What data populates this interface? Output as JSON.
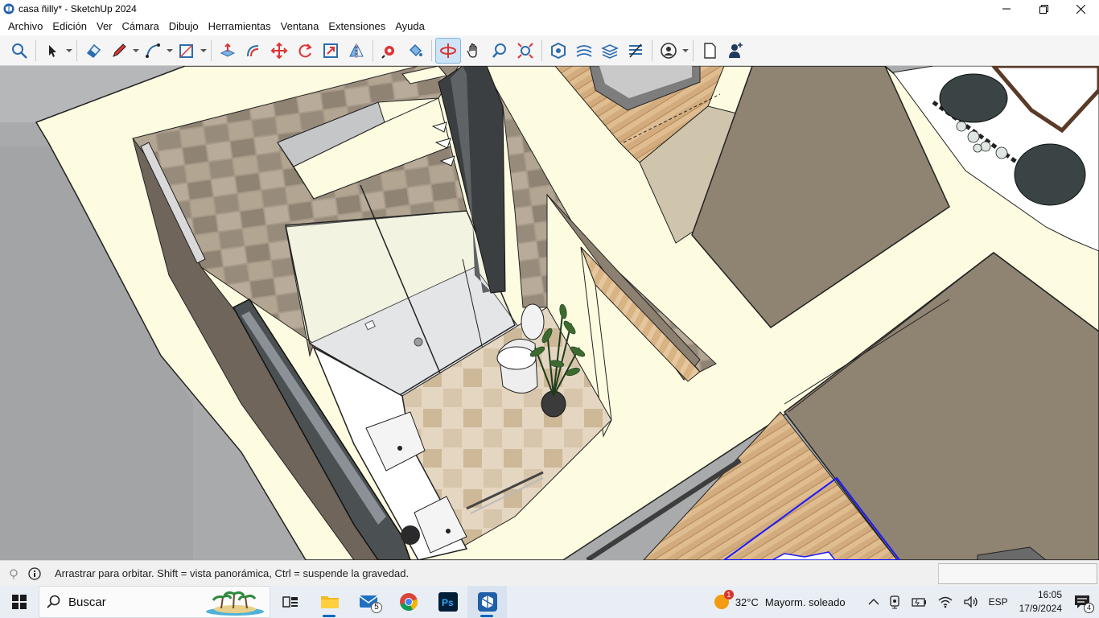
{
  "window": {
    "title": "casa ñilly* - SketchUp 2024",
    "app_icon": "sketchup-icon",
    "controls": [
      "minimize-icon",
      "restore-icon",
      "close-icon"
    ]
  },
  "menubar": {
    "items": [
      {
        "label": "Archivo"
      },
      {
        "label": "Edición"
      },
      {
        "label": "Ver"
      },
      {
        "label": "Cámara"
      },
      {
        "label": "Dibujo"
      },
      {
        "label": "Herramientas"
      },
      {
        "label": "Ventana"
      },
      {
        "label": "Extensiones"
      },
      {
        "label": "Ayuda"
      }
    ]
  },
  "toolbar": {
    "tools": [
      "search-icon",
      "select-arrow-icon",
      "eraser-icon",
      "pencil-icon",
      "arc-icon",
      "rectangle-icon",
      "push-pull-icon",
      "offset-icon",
      "move-icon",
      "rotate-icon",
      "scale-icon",
      "flip-icon",
      "tape-measure-icon",
      "paint-bucket-icon",
      "orbit-icon",
      "pan-icon",
      "zoom-icon",
      "zoom-extents-icon",
      "solid-tools-icon",
      "sandbox-icon",
      "layers-icon",
      "styles-icon",
      "account-icon",
      "new-document-icon",
      "user-add-icon"
    ],
    "active_tool": "orbit-icon"
  },
  "statusbar": {
    "hint_text": "Arrastrar para orbitar. Shift = vista panorámica, Ctrl = suspende la gravedad.",
    "measurements_value": ""
  },
  "taskbar": {
    "search_label": "Buscar",
    "mail_badge": "5",
    "weather_temp": "32°C",
    "weather_text": "Mayorm. soleado",
    "weather_alert": "1",
    "language": "ESP",
    "time": "16:05",
    "date": "17/9/2024",
    "notifications_count": "4"
  },
  "colors": {
    "accent": "#0067c0",
    "wall_top": "#fdfbe0",
    "tile": "#a69a89",
    "wood_floor": "#c8a178",
    "dark_grey": "#8f8372"
  }
}
